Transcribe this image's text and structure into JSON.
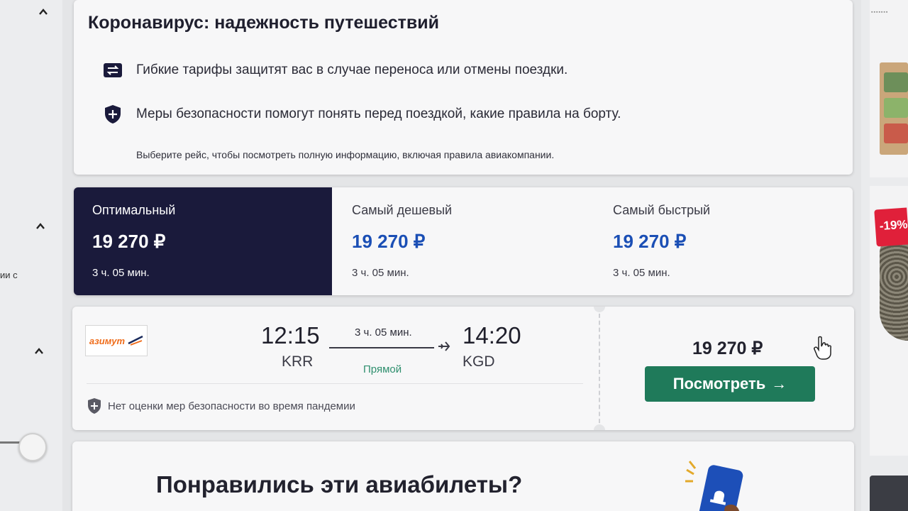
{
  "covid": {
    "title": "Коронавирус: надежность путешествий",
    "items": [
      {
        "icon": "refund-icon",
        "text": "Гибкие тарифы защитят вас в случае переноса или отмены поездки."
      },
      {
        "icon": "shield-icon",
        "text": "Меры безопасности помогут понять перед поездкой, какие правила на борту."
      }
    ],
    "note": "Выберите рейс, чтобы посмотреть полную информацию, включая правила авиакомпании."
  },
  "tabs": [
    {
      "label": "Оптимальный",
      "price": "19 270 ₽",
      "duration": "3 ч. 05 мин.",
      "active": true
    },
    {
      "label": "Самый дешевый",
      "price": "19 270 ₽",
      "duration": "3 ч. 05 мин.",
      "active": false
    },
    {
      "label": "Самый быстрый",
      "price": "19 270 ₽",
      "duration": "3 ч. 05 мин.",
      "active": false
    }
  ],
  "flight": {
    "airline": "азимут",
    "depart_time": "12:15",
    "depart_code": "KRR",
    "arrive_time": "14:20",
    "arrive_code": "KGD",
    "duration": "3 ч. 05 мин.",
    "stops": "Прямой",
    "safety_note": "Нет оценки мер безопасности во время пандемии",
    "price": "19 270 ₽",
    "cta": "Посмотреть",
    "cta_arrow": "→"
  },
  "promo": {
    "title": "Понравились эти авиабилеты?"
  },
  "left_sidebar": {
    "text": "ии с"
  },
  "right_sidebar": {
    "sale": "-19%"
  },
  "colors": {
    "accent": "#1f7a5a",
    "tab_active": "#1a1a3b",
    "price_blue": "#1b4fb5",
    "airline_orange": "#ef6c1a",
    "sale_red": "#e0203a"
  }
}
